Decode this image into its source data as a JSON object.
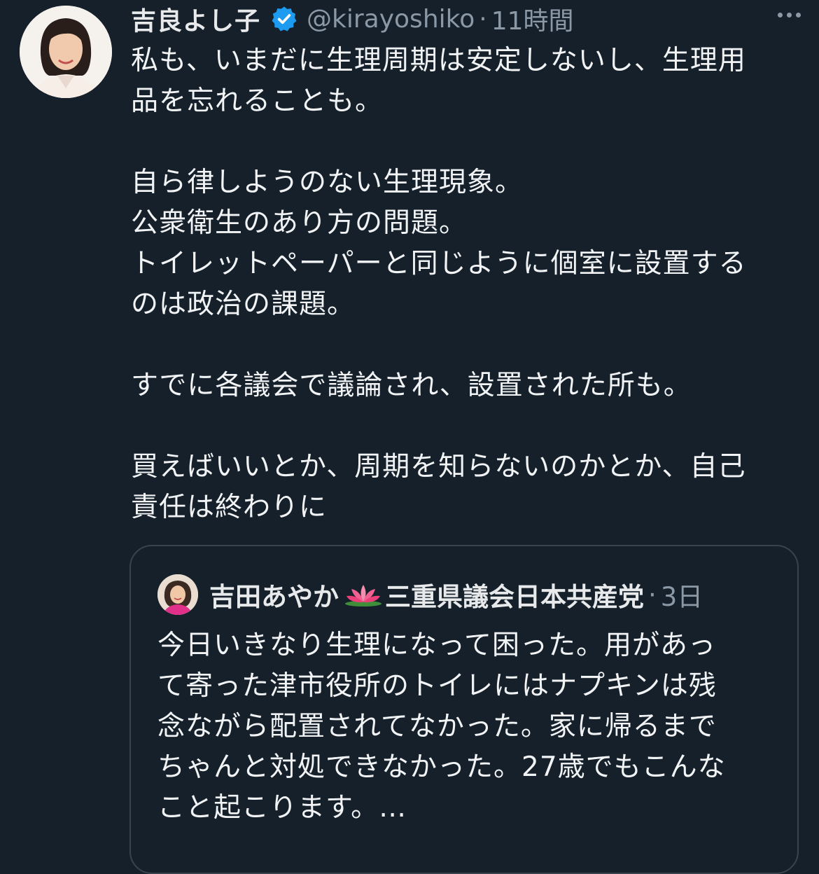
{
  "tweet": {
    "display_name": "吉良よし子",
    "handle": "@kirayoshiko",
    "separator": "·",
    "time": "11時間",
    "paragraphs": [
      "私も、いまだに生理周期は安定しないし、生理用\n品を忘れることも。",
      "自ら律しようのない生理現象。\n公衆衛生のあり方の問題。\nトイレットペーパーと同じように個室に設置する\nのは政治の課題。",
      "すでに各議会で議論され、設置された所も。",
      "買えばいいとか、周期を知らないのかとか、自己\n責任は終わりに"
    ]
  },
  "quoted_tweet": {
    "display_name_part1": "吉田あやか",
    "display_name_part2": "三重県議会日本共産党",
    "separator": "·",
    "time": "3日",
    "text": "今日いきなり生理になって困った。用があっ\nて寄った津市役所のトイレにはナプキンは残\n念ながら配置されてなかった。家に帰るまで\nちゃんと対処できなかった。27歳でもこんな\nこと起こります。…"
  },
  "icons": {
    "verified": "verified-badge-icon",
    "more": "more-icon",
    "lotus": "lotus-emoji-icon"
  },
  "colors": {
    "background": "#15202b",
    "text": "#e7e9ea",
    "secondary_text": "#8b98a5",
    "verified_blue": "#1d9bf0",
    "card_border": "#38444d"
  }
}
